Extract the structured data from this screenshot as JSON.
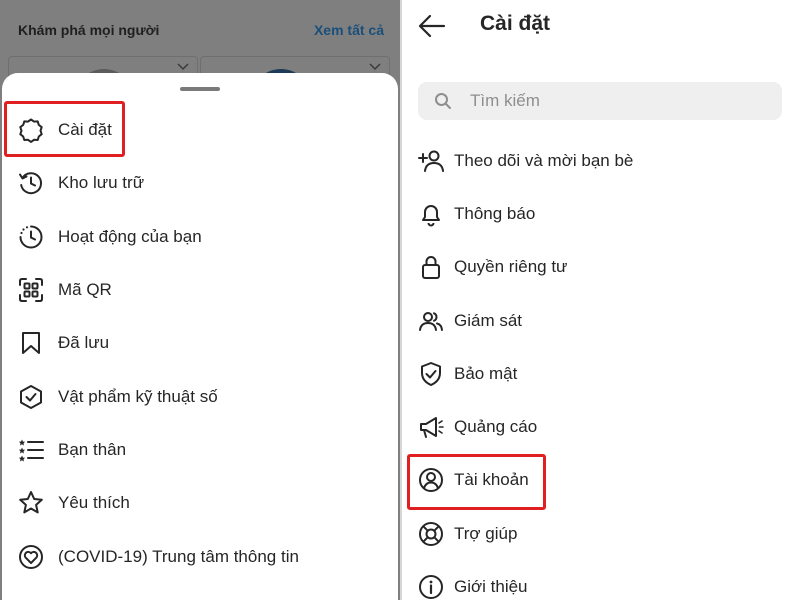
{
  "explore": {
    "title": "Khám phá mọi người",
    "see_all": "Xem tất cả"
  },
  "menu": {
    "items": [
      {
        "label": "Cài đặt",
        "icon": "gear-icon"
      },
      {
        "label": "Kho lưu trữ",
        "icon": "archive-history-icon"
      },
      {
        "label": "Hoạt động của bạn",
        "icon": "activity-clock-icon"
      },
      {
        "label": "Mã QR",
        "icon": "qr-code-icon"
      },
      {
        "label": "Đã lưu",
        "icon": "bookmark-icon"
      },
      {
        "label": "Vật phẩm kỹ thuật số",
        "icon": "shield-check-icon"
      },
      {
        "label": "Bạn thân",
        "icon": "close-friends-list-icon"
      },
      {
        "label": "Yêu thích",
        "icon": "star-icon"
      },
      {
        "label": "(COVID-19) Trung tâm thông tin",
        "icon": "heart-info-icon"
      }
    ]
  },
  "settings": {
    "title": "Cài đặt",
    "search_placeholder": "Tìm kiếm",
    "items": [
      {
        "label": "Theo dõi và mời bạn bè",
        "icon": "add-person-icon"
      },
      {
        "label": "Thông báo",
        "icon": "bell-icon"
      },
      {
        "label": "Quyền riêng tư",
        "icon": "lock-icon"
      },
      {
        "label": "Giám sát",
        "icon": "people-icon"
      },
      {
        "label": "Bảo mật",
        "icon": "shield-check-icon"
      },
      {
        "label": "Quảng cáo",
        "icon": "megaphone-icon"
      },
      {
        "label": "Tài khoản",
        "icon": "account-circle-icon"
      },
      {
        "label": "Trợ giúp",
        "icon": "lifebuoy-icon"
      },
      {
        "label": "Giới thiệu",
        "icon": "info-icon"
      }
    ]
  },
  "colors": {
    "highlight": "#e02020",
    "overlay": "#7f7f7f",
    "text": "#262626",
    "search_bg": "#efefef"
  }
}
